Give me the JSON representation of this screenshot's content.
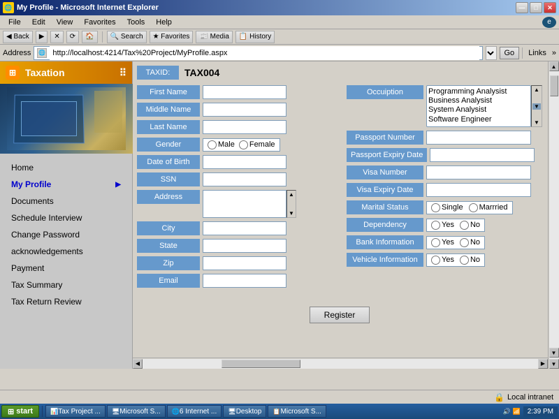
{
  "window": {
    "title": "My Profile - Microsoft Internet Explorer",
    "icon": "🌐"
  },
  "titlebar": {
    "buttons": {
      "minimize": "—",
      "maximize": "□",
      "close": "✕"
    }
  },
  "menubar": {
    "items": [
      "File",
      "Edit",
      "View",
      "Favorites",
      "Tools",
      "Help"
    ]
  },
  "addressbar": {
    "label": "Address",
    "url": "http://localhost:4214/Tax%20Project/MyProfile.aspx",
    "go": "Go",
    "links": "Links"
  },
  "ie_toolbar": {
    "buttons": [
      "◀",
      "▶",
      "✕",
      "⟳",
      "🏠",
      "🔍",
      "★",
      "📰",
      "✉",
      "🖨",
      "✏"
    ]
  },
  "sidebar": {
    "title": "Taxation",
    "nav_items": [
      {
        "label": "Home",
        "active": false,
        "arrow": false
      },
      {
        "label": "My Profile",
        "active": true,
        "arrow": true
      },
      {
        "label": "Documents",
        "active": false,
        "arrow": false
      },
      {
        "label": "Schedule Interview",
        "active": false,
        "arrow": false
      },
      {
        "label": "Change Password",
        "active": false,
        "arrow": false
      },
      {
        "label": "acknowledgements",
        "active": false,
        "arrow": false
      },
      {
        "label": "Payment",
        "active": false,
        "arrow": false
      },
      {
        "label": "Tax Summary",
        "active": false,
        "arrow": false
      },
      {
        "label": "Tax Return Review",
        "active": false,
        "arrow": false
      }
    ]
  },
  "form": {
    "taxid_label": "TAXID:",
    "taxid_value": "TAX004",
    "fields": {
      "first_name": {
        "label": "First Name",
        "value": ""
      },
      "middle_name": {
        "label": "Middle Name",
        "value": ""
      },
      "last_name": {
        "label": "Last Name",
        "value": ""
      },
      "gender": {
        "label": "Gender",
        "options": [
          "Male",
          "Female"
        ]
      },
      "date_of_birth": {
        "label": "Date of Birth",
        "value": ""
      },
      "ssn": {
        "label": "SSN",
        "value": ""
      },
      "address": {
        "label": "Address",
        "value": ""
      },
      "city": {
        "label": "City",
        "value": ""
      },
      "state": {
        "label": "State",
        "value": ""
      },
      "zip": {
        "label": "Zip",
        "value": ""
      },
      "email": {
        "label": "Email",
        "value": ""
      }
    },
    "right_fields": {
      "occupation": {
        "label": "Occuiption",
        "options": [
          "Programming Analysist",
          "Business Analysist",
          "System Analysist",
          "Software Engineer"
        ]
      },
      "passport_number": {
        "label": "Passport Number",
        "value": ""
      },
      "passport_expiry": {
        "label": "Passport Expiry Date",
        "value": ""
      },
      "visa_number": {
        "label": "Visa Number",
        "value": ""
      },
      "visa_expiry": {
        "label": "Visa Expiry Date",
        "value": ""
      },
      "marital_status": {
        "label": "Marital Status",
        "options": [
          "Single",
          "Marrried"
        ]
      },
      "dependency": {
        "label": "Dependency",
        "options": [
          "Yes",
          "No"
        ]
      },
      "bank_information": {
        "label": "Bank Information",
        "options": [
          "Yes",
          "No"
        ]
      },
      "vehicle_information": {
        "label": "Vehicle Information",
        "options": [
          "Yes",
          "No"
        ]
      }
    },
    "register_btn": "Register"
  },
  "statusbar": {
    "text": "Local intranet"
  },
  "taskbar": {
    "start": "start",
    "items": [
      "Tax Project ...",
      "Microsoft S...",
      "6 Internet ...",
      "Desktop",
      "Microsoft S..."
    ],
    "time": "2:39 PM"
  }
}
